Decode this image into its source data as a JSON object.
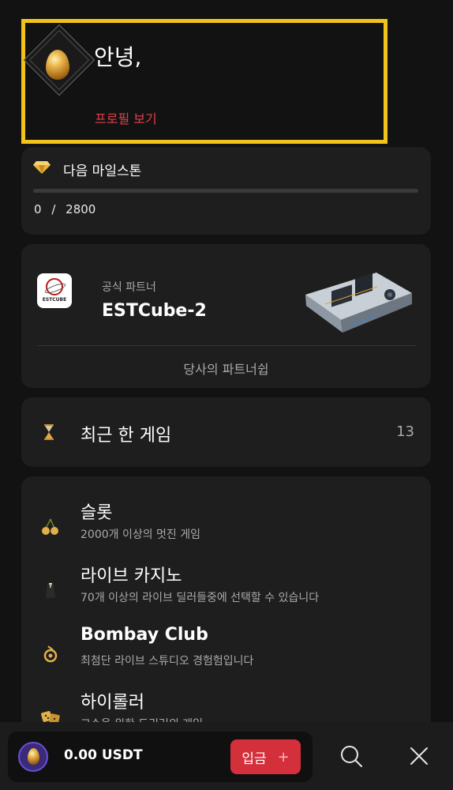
{
  "profile": {
    "greeting": "안녕,",
    "link": "프로필 보기",
    "badge_icon": "golden-egg-icon",
    "accent_color": "#f2c318"
  },
  "milestone": {
    "icon": "diamond-icon",
    "title": "다음 마일스톤",
    "current": "0",
    "separator": "/",
    "target": "2800",
    "progress_fraction": 0
  },
  "partner": {
    "kicker": "공식 파트너",
    "name": "ESTCube-2",
    "logo_text": "ESTCUBE",
    "link": "당사의 파트너쉽"
  },
  "recent": {
    "icon": "hourglass-icon",
    "title": "최근 한 게임",
    "count": "13"
  },
  "menu": [
    {
      "icon": "cherries-icon",
      "title": "슬롯",
      "subtitle": "2000개 이상의 멋진 게임"
    },
    {
      "icon": "tuxedo-icon",
      "title": "라이브 카지노",
      "subtitle": "70개 이상의 라이브 딜러들중에 선택할 수 있습니다"
    },
    {
      "icon": "bombay-club-icon",
      "title": "Bombay Club",
      "subtitle": "최첨단 라이브 스튜디오 경험험입니다"
    },
    {
      "icon": "dice-icon",
      "title": "하이롤러",
      "subtitle": "고수을 위한 도리러의 게임"
    }
  ],
  "bottom": {
    "balance": "0.00 USDT",
    "deposit_label": "입금",
    "deposit_plus": "+",
    "brand_color": "#d4303c"
  }
}
